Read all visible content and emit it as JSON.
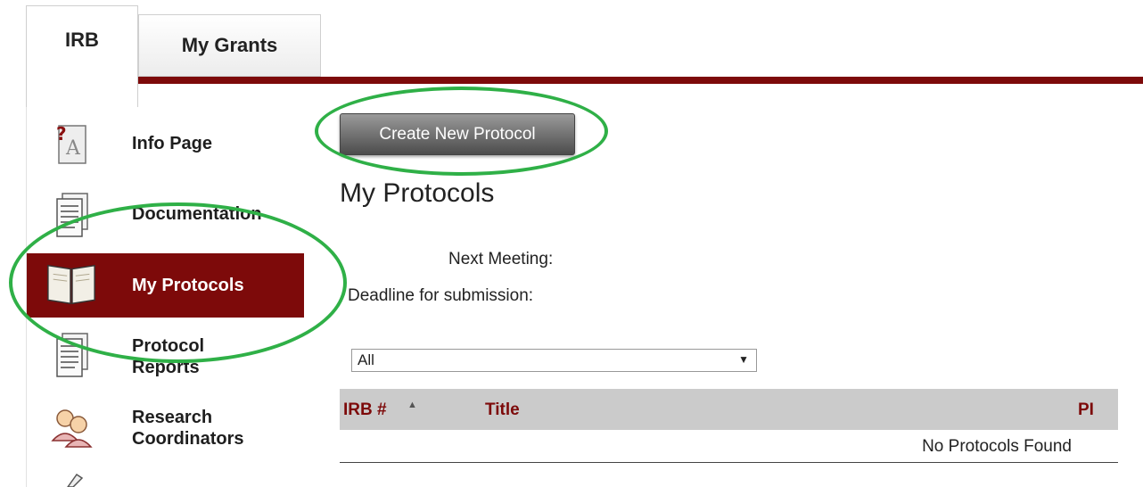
{
  "tabs": [
    {
      "label": "IRB",
      "active": true
    },
    {
      "label": "My Grants",
      "active": false
    }
  ],
  "sidebar": {
    "items": [
      {
        "label": "Info Page",
        "icon": "help-document-icon"
      },
      {
        "label": "Documentation",
        "icon": "document-icon"
      },
      {
        "label": "My Protocols",
        "icon": "open-book-icon",
        "active": true
      },
      {
        "label": "Protocol\nReports",
        "icon": "report-icon"
      },
      {
        "label": "Research\nCoordinators",
        "icon": "users-icon"
      }
    ]
  },
  "main": {
    "create_button": "Create New Protocol",
    "page_title": "My Protocols",
    "next_meeting_label": "Next Meeting:",
    "deadline_label": "Deadline for submission:",
    "filter": {
      "selected": "All"
    },
    "table": {
      "columns": [
        "IRB #",
        "Title",
        "PI"
      ],
      "empty_message": "No Protocols Found"
    }
  },
  "colors": {
    "accent": "#7d0a0a",
    "highlight": "#2fb047",
    "header_bg": "#cbcbcb"
  }
}
